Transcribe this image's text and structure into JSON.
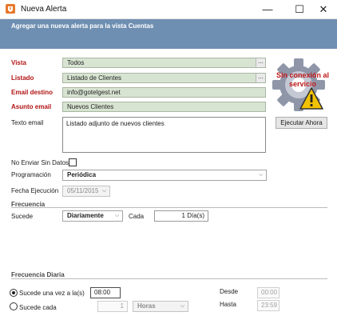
{
  "window": {
    "title": "Nueva Alerta",
    "minimize_glyph": "—",
    "maximize_glyph": "☐",
    "close_glyph": "✕"
  },
  "header": {
    "text": "Agregar una nueva alerta para la vista Cuentas"
  },
  "form": {
    "vista": {
      "label": "Vista",
      "value": "Todos",
      "button": "..."
    },
    "listado": {
      "label": "Listado",
      "value": "Listado de Clientes",
      "button": "..."
    },
    "email_destino": {
      "label": "Email destino",
      "value": "info@gotelgest.net"
    },
    "asunto_email": {
      "label": "Asunto email",
      "value": "Nuevos Clientes"
    },
    "texto_email": {
      "label": "Texto email",
      "value": "Listado adjunto de nuevos clientes"
    },
    "no_enviar": {
      "label": "No Enviar Sin Datos"
    },
    "programacion": {
      "label": "Programación",
      "value": "Periódica"
    },
    "fecha_ejecucion": {
      "label": "Fecha Ejecución",
      "value": "05/11/2015"
    }
  },
  "status": {
    "logo_text": "Sin conexión al servicio",
    "run_button": "Ejecutar Ahora"
  },
  "frecuencia": {
    "title": "Frecuencia",
    "sucede_label": "Sucede",
    "sucede_value": "Diariamente",
    "cada_label": "Cada",
    "cada_value": "1 Día(s)"
  },
  "frecuencia_diaria": {
    "title": "Frecuencia Diaria",
    "once_label": "Sucede una vez a la(s)",
    "once_value": "08:00",
    "every_label": "Sucede cada",
    "every_value": "1",
    "every_unit": "Horas",
    "desde_label": "Desde",
    "desde_value": "00:00",
    "hasta_label": "Hasta",
    "hasta_value": "23:59"
  },
  "colors": {
    "header_band": "#6f8fb2",
    "required_label": "#b21414",
    "readonly_field": "#d8e4d2"
  },
  "icons": {
    "app": "alert-window-icon",
    "status": "gear-warning-icon"
  }
}
